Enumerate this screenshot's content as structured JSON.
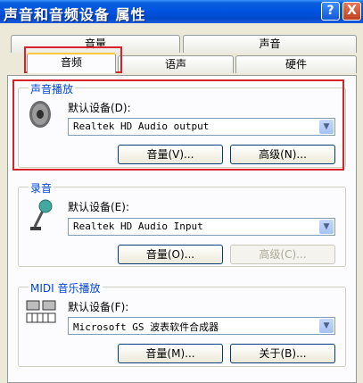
{
  "window": {
    "title": "声音和音频设备 属性",
    "help_label": "?",
    "close_label": "X"
  },
  "tabs": {
    "row1": [
      {
        "label": "音量"
      },
      {
        "label": "声音"
      }
    ],
    "row2": [
      {
        "label": "音频",
        "active": true
      },
      {
        "label": "语声"
      },
      {
        "label": "硬件"
      }
    ]
  },
  "playback": {
    "title": "声音播放",
    "device_label": "默认设备(D):",
    "device_value": "Realtek HD Audio output",
    "volume_button": "音量(V)...",
    "advanced_button": "高级(N)...",
    "icon": "speaker-icon"
  },
  "recording": {
    "title": "录音",
    "device_label": "默认设备(E):",
    "device_value": "Realtek HD Audio Input",
    "volume_button": "音量(O)...",
    "advanced_button": "高级(C)...",
    "advanced_disabled": true,
    "icon": "microphone-icon"
  },
  "midi": {
    "title": "MIDI 音乐播放",
    "device_label": "默认设备(F):",
    "device_value": "Microsoft GS 波表软件合成器",
    "volume_button": "音量(M)...",
    "about_button": "关于(B)...",
    "icon": "midi-keyboard-icon"
  },
  "colors": {
    "titlebar": "#0054e3",
    "group_title": "#0046d5",
    "highlight_box": "#d6222a",
    "active_tab_accent": "#ffc83c"
  }
}
